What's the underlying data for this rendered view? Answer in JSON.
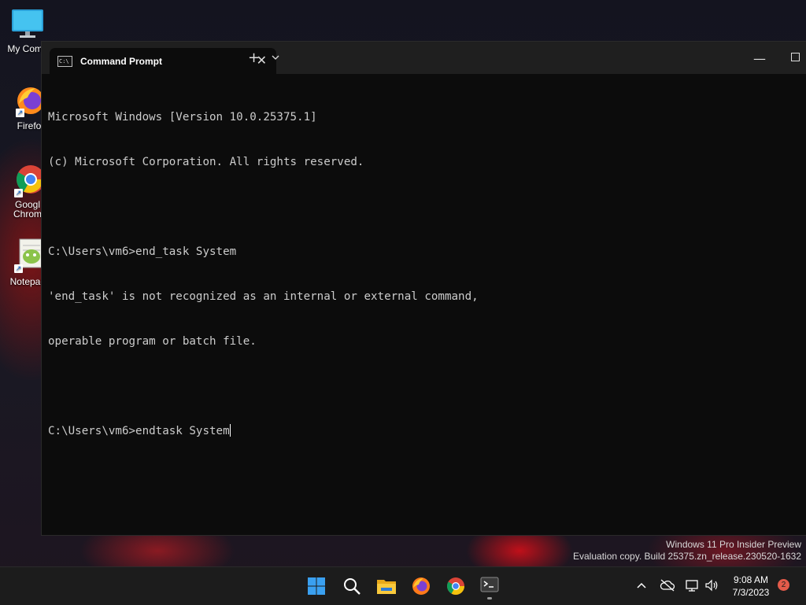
{
  "desktop": {
    "icons": [
      {
        "label": "My Comp"
      },
      {
        "label": "Firefo"
      },
      {
        "label_line1": "Googl",
        "label_line2": "Chrom"
      },
      {
        "label": "Notepac"
      }
    ]
  },
  "window": {
    "tab_title": "Command Prompt",
    "tab_close_icon": "✕",
    "new_tab_icon": "+",
    "minimize_icon": "—"
  },
  "console": {
    "lines": [
      "Microsoft Windows [Version 10.0.25375.1]",
      "(c) Microsoft Corporation. All rights reserved.",
      "",
      "C:\\Users\\vm6>end_task System",
      "'end_task' is not recognized as an internal or external command,",
      "operable program or batch file.",
      "",
      "C:\\Users\\vm6>endtask System"
    ]
  },
  "watermark": {
    "line1": "Windows 11 Pro Insider Preview",
    "line2": "Evaluation copy. Build 25375.zn_release.230520-1632"
  },
  "taskbar": {
    "apps": [
      "start-icon",
      "search-icon",
      "file-explorer-icon",
      "firefox-icon",
      "chrome-icon",
      "terminal-icon"
    ],
    "tray": {
      "time": "9:08 AM",
      "date": "7/3/2023",
      "notification_count": "2"
    }
  },
  "colors": {
    "console_bg": "#0c0c0c",
    "console_fg": "#cccccc",
    "taskbar_bg": "#1c1c1c",
    "badge": "#e35b4a"
  }
}
